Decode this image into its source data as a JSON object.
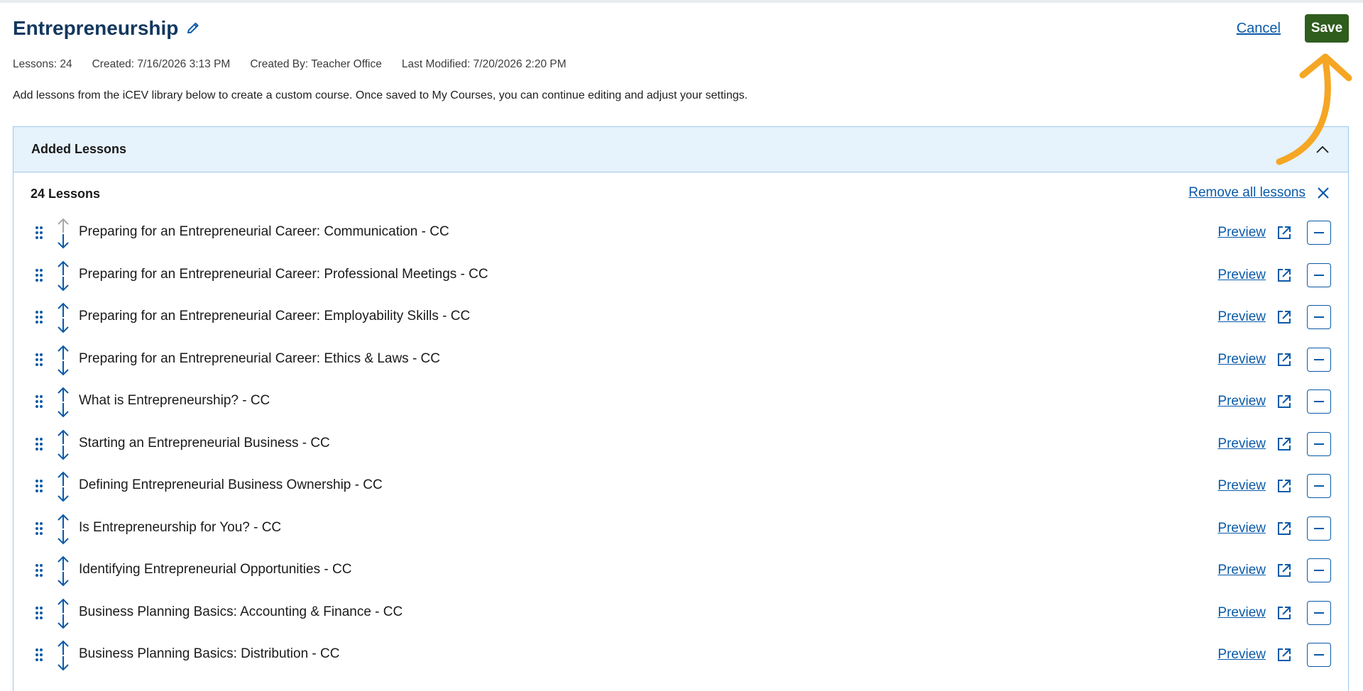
{
  "colors": {
    "title": "#13385f",
    "link": "#0a5aa8",
    "save_bg": "#2f5d1e",
    "panel_header_bg": "#e6f2fc",
    "panel_border": "#9cc7ec",
    "annotation_arrow": "#f5a623"
  },
  "header": {
    "title": "Entrepreneurship",
    "edit_icon": "pencil-icon",
    "cancel_label": "Cancel",
    "save_label": "Save"
  },
  "meta": {
    "lessons": "Lessons: 24",
    "created": "Created: 7/16/2026 3:13 PM",
    "created_by": "Created By: Teacher Office",
    "last_modified": "Last Modified: 7/20/2026 2:20 PM"
  },
  "description": "Add lessons from the iCEV library below to create a custom course. Once saved to My Courses, you can continue editing and adjust your settings.",
  "panel": {
    "title": "Added Lessons",
    "collapse_icon": "chevron-up-icon",
    "count_label": "24 Lessons",
    "remove_all_label": "Remove all lessons",
    "remove_all_icon": "close-icon"
  },
  "lesson_actions": {
    "preview_label": "Preview",
    "external_icon": "external-link-icon",
    "remove_icon": "minus-icon"
  },
  "lessons": [
    {
      "title": "Preparing for an Entrepreneurial Career: Communication - CC",
      "up_enabled": false
    },
    {
      "title": "Preparing for an Entrepreneurial Career: Professional Meetings - CC",
      "up_enabled": true
    },
    {
      "title": "Preparing for an Entrepreneurial Career: Employability Skills - CC",
      "up_enabled": true
    },
    {
      "title": "Preparing for an Entrepreneurial Career: Ethics & Laws - CC",
      "up_enabled": true
    },
    {
      "title": "What is Entrepreneurship? - CC",
      "up_enabled": true
    },
    {
      "title": "Starting an Entrepreneurial Business - CC",
      "up_enabled": true
    },
    {
      "title": "Defining Entrepreneurial Business Ownership - CC",
      "up_enabled": true
    },
    {
      "title": "Is Entrepreneurship for You? - CC",
      "up_enabled": true
    },
    {
      "title": "Identifying Entrepreneurial Opportunities - CC",
      "up_enabled": true
    },
    {
      "title": "Business Planning Basics: Accounting & Finance - CC",
      "up_enabled": true
    },
    {
      "title": "Business Planning Basics: Distribution - CC",
      "up_enabled": true
    }
  ]
}
